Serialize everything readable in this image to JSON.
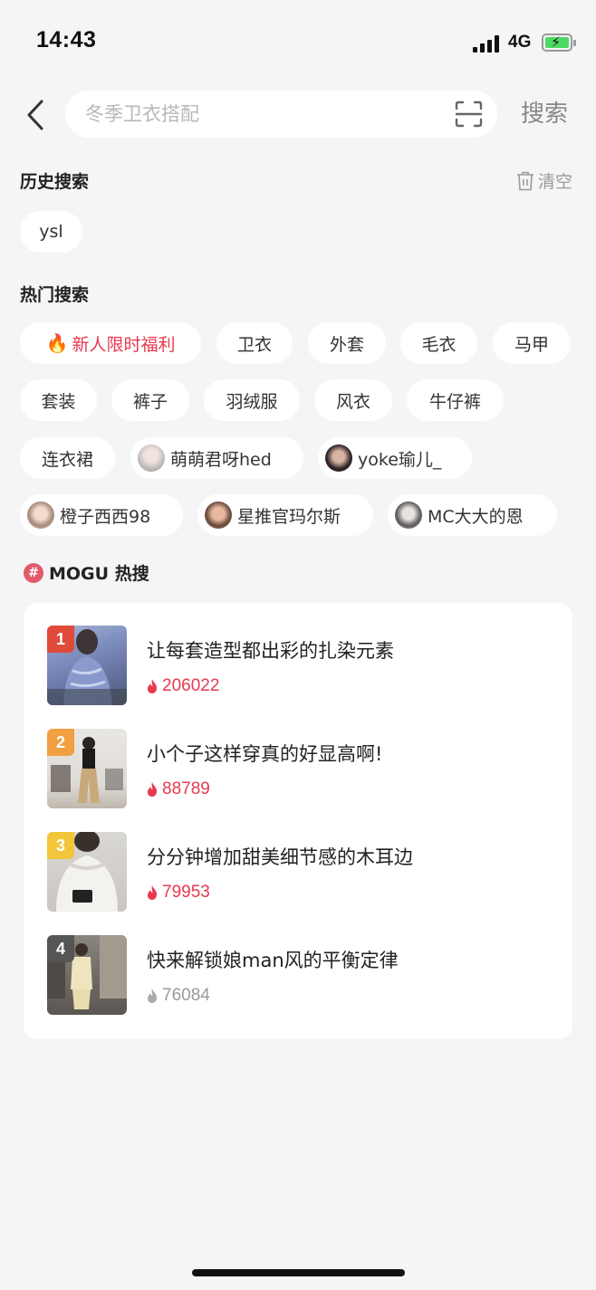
{
  "status_bar": {
    "time": "14:43",
    "network": "4G"
  },
  "search": {
    "placeholder": "冬季卫衣搭配",
    "button_label": "搜索"
  },
  "history": {
    "title": "历史搜索",
    "clear_label": "清空",
    "items": [
      "ysl"
    ]
  },
  "hot_search": {
    "title": "热门搜索",
    "promo_label": "新人限时福利",
    "row1": [
      "卫衣",
      "外套",
      "毛衣",
      "马甲"
    ],
    "row2": [
      "套装",
      "裤子",
      "羽绒服",
      "风衣",
      "牛仔裤"
    ],
    "row3_tag": "连衣裙",
    "users": [
      "萌萌君呀hed",
      "yoke瑜儿_",
      "橙子西西98",
      "星推官玛尔斯",
      "MC大大的恩"
    ]
  },
  "mogu": {
    "title": "MOGU 热搜",
    "hash_symbol": "#",
    "items": [
      {
        "rank": "1",
        "title": "让每套造型都出彩的扎染元素",
        "count": "206022"
      },
      {
        "rank": "2",
        "title": "小个子这样穿真的好显高啊!",
        "count": "88789"
      },
      {
        "rank": "3",
        "title": "分分钟增加甜美细节感的木耳边",
        "count": "79953"
      },
      {
        "rank": "4",
        "title": "快来解锁娘man风的平衡定律",
        "count": "76084"
      }
    ]
  },
  "colors": {
    "accent": "#e8394f",
    "rank1": "#e04a3a",
    "rank2": "#f0a040",
    "rank3": "#f3c53a",
    "rank4": "#555555"
  }
}
